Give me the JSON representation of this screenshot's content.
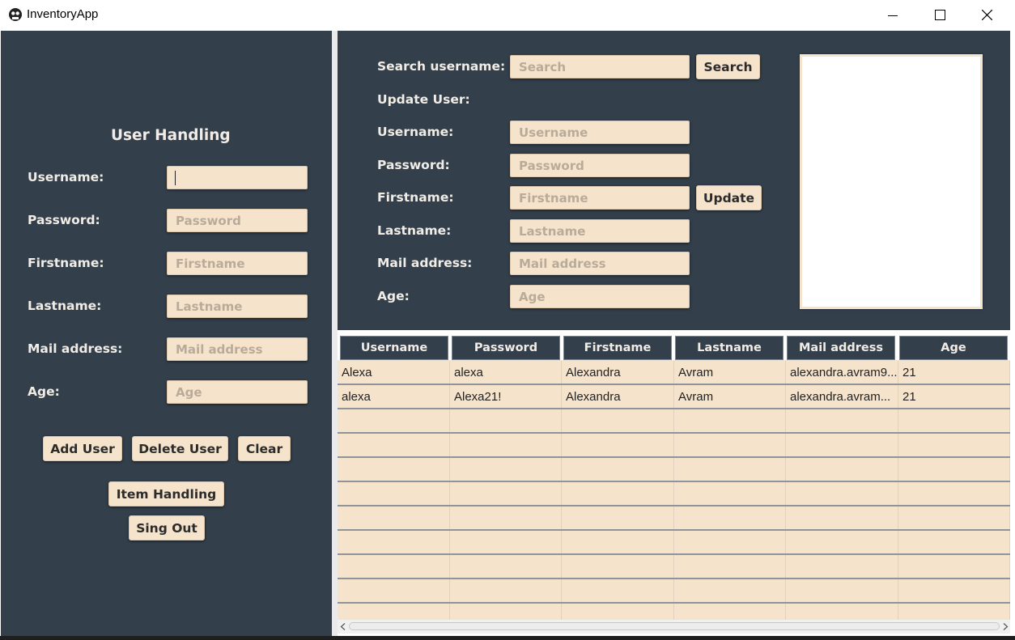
{
  "window": {
    "title": "InventoryApp"
  },
  "colors": {
    "panel": "#333f4a",
    "field": "#f6e3cc",
    "label": "#f1ede6"
  },
  "left": {
    "heading": "User Handling",
    "labels": {
      "username": "Username:",
      "password": "Password:",
      "firstname": "Firstname:",
      "lastname": "Lastname:",
      "mail": "Mail address:",
      "age": "Age:"
    },
    "placeholders": {
      "username": "",
      "password": "Password",
      "firstname": "Firstname",
      "lastname": "Lastname",
      "mail": "Mail address",
      "age": "Age"
    },
    "buttons": {
      "add": "Add User",
      "delete": "Delete User",
      "clear": "Clear",
      "items": "Item Handling",
      "signout": "Sing Out"
    }
  },
  "search": {
    "label": "Search username:",
    "placeholder": "Search",
    "button": "Search"
  },
  "update": {
    "heading": "Update User:",
    "labels": {
      "username": "Username:",
      "password": "Password:",
      "firstname": "Firstname:",
      "lastname": "Lastname:",
      "mail": "Mail address:",
      "age": "Age:"
    },
    "placeholders": {
      "username": "Username",
      "password": "Password",
      "firstname": "Firstname",
      "lastname": "Lastname",
      "mail": "Mail address",
      "age": "Age"
    },
    "button": "Update"
  },
  "table": {
    "columns": [
      "Username",
      "Password",
      "Firstname",
      "Lastname",
      "Mail address",
      "Age"
    ],
    "rows": [
      [
        "Alexa",
        "alexa",
        "Alexandra",
        "Avram",
        "alexandra.avram9...",
        "21"
      ],
      [
        "alexa",
        "Alexa21!",
        "Alexandra",
        "Avram",
        "alexandra.avram...",
        "21"
      ]
    ]
  }
}
